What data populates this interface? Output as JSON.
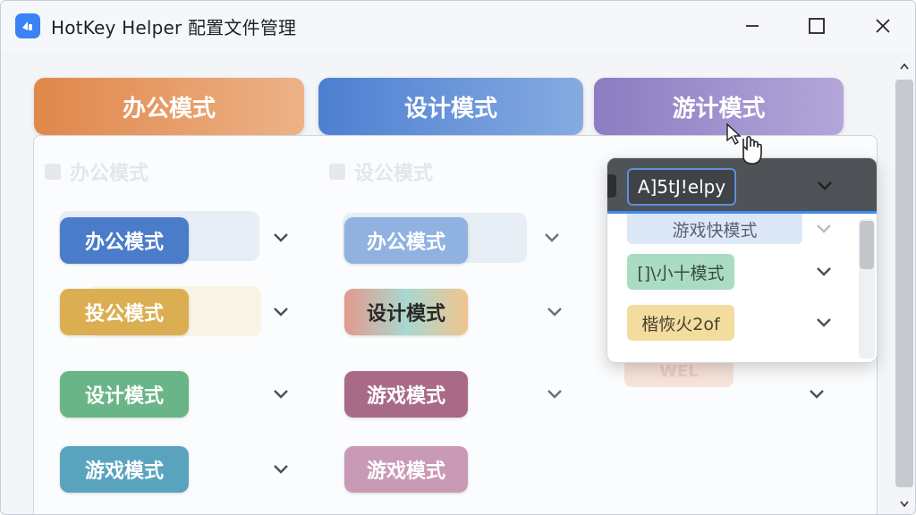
{
  "window": {
    "title": "HotKey Helper  配置文件管理",
    "icon": "app-logo-icon",
    "controls": [
      "minimize-icon",
      "maximize-icon",
      "close-icon"
    ]
  },
  "tabs": [
    {
      "label": "办公模式",
      "color": "#e0874a"
    },
    {
      "label": "设计模式",
      "color": "#4d7fd1"
    },
    {
      "label": "游计模式",
      "color": "#8c7cc1"
    }
  ],
  "panel": {
    "ghost_headers": [
      "办公模式",
      "设公模式"
    ],
    "column1": [
      {
        "label": "办公模式",
        "color": "#4a7cc9"
      },
      {
        "label": "投公模式",
        "color": "#dcae52"
      },
      {
        "label": "设计模式",
        "color": "#6ab587"
      },
      {
        "label": "游戏模式",
        "color": "#5aa3bf"
      }
    ],
    "column2": [
      {
        "label": "办公模式",
        "color": "#8fb2e0"
      },
      {
        "label": "设计模式",
        "color": "#e39a8c"
      },
      {
        "label": "游戏模式",
        "color": "#a86a86"
      },
      {
        "label": "游戏模式",
        "color": "#c99ab6"
      }
    ]
  },
  "dropdown": {
    "selected": "A]5tJ!elpy",
    "items": [
      {
        "label": "游戏快模式",
        "color": "#dde8f7",
        "text_color": "#5a6170"
      },
      {
        "label": "[]\\小十模式",
        "color": "#a9dcc3",
        "text_color": "#3c4a44"
      },
      {
        "label": "楷恢火2of",
        "color": "#f2dc9e",
        "text_color": "#4a4230"
      }
    ],
    "ghost_item": "WEL"
  }
}
